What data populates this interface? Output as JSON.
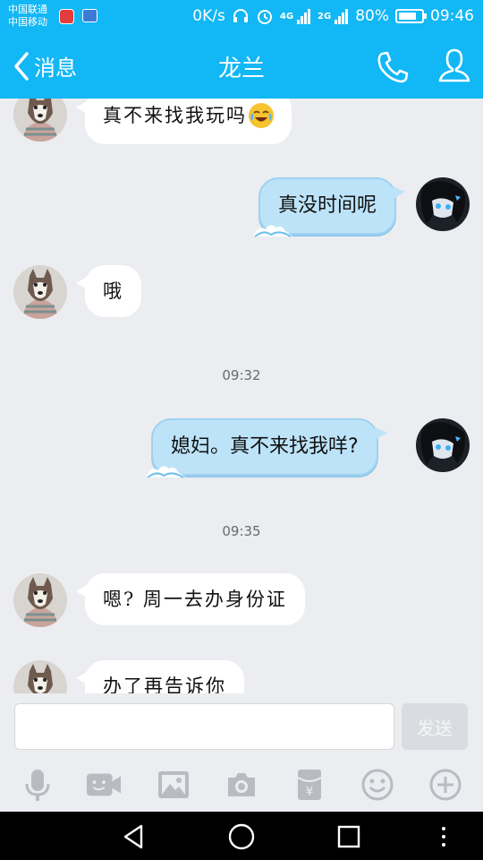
{
  "status_bar": {
    "carrier1": "中国联通",
    "carrier2": "中国移动",
    "speed": "0K/s",
    "net1": "4G",
    "net2": "2G",
    "battery": "80%",
    "battery_level": 0.8,
    "time": "09:46"
  },
  "header": {
    "back_label": "消息",
    "title": "龙兰"
  },
  "messages": [
    {
      "side": "in",
      "text": "真不来找我玩吗",
      "emoji": "laughing-crying-emoji"
    },
    {
      "side": "out",
      "text": "真没时间呢"
    },
    {
      "side": "in",
      "text": "哦"
    },
    {
      "type": "time",
      "text": "09:32"
    },
    {
      "side": "out",
      "text": "媳妇。真不来找我咩?"
    },
    {
      "type": "time",
      "text": "09:35"
    },
    {
      "side": "in",
      "text": "嗯? 周一去办身份证"
    },
    {
      "side": "in",
      "text": "办了再告诉你"
    }
  ],
  "input": {
    "value": "",
    "send_label": "发送"
  },
  "toolbar": [
    "microphone-icon",
    "video-chat-icon",
    "image-icon",
    "camera-icon",
    "red-packet-icon",
    "emoji-icon",
    "plus-icon"
  ],
  "colors": {
    "accent": "#12b7f5",
    "background": "#ebedf0",
    "outgoing_bubble": "#bde3f8",
    "incoming_bubble": "#ffffff"
  }
}
